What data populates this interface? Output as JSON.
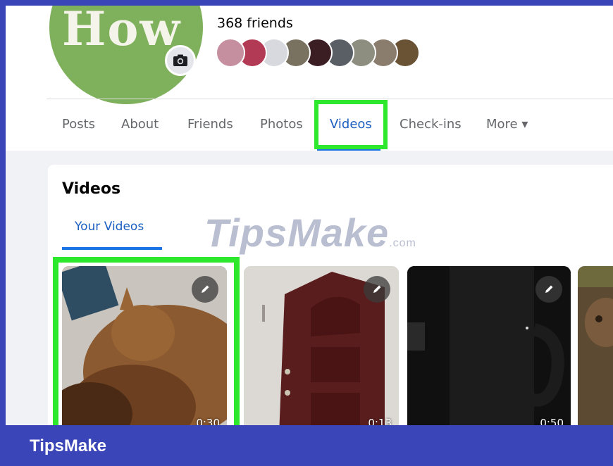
{
  "profile": {
    "avatar_text": "How",
    "friends_count": "368 friends",
    "friend_avatar_colors": [
      "#c58fa0",
      "#b33a55",
      "#d7d9de",
      "#7a7260",
      "#3b1d24",
      "#5a5f66",
      "#8d8e80",
      "#8a7d6e",
      "#6a5235"
    ]
  },
  "tabs": {
    "items": [
      {
        "label": "Posts"
      },
      {
        "label": "About"
      },
      {
        "label": "Friends"
      },
      {
        "label": "Photos"
      },
      {
        "label": "Videos"
      },
      {
        "label": "Check-ins"
      },
      {
        "label": "More ▾"
      }
    ],
    "active": "Videos"
  },
  "videos_section": {
    "title": "Videos",
    "subtab": "Your Videos",
    "items": [
      {
        "duration": "0:30",
        "icon": "pencil-icon"
      },
      {
        "duration": "0:13",
        "icon": "pencil-icon"
      },
      {
        "duration": "0:50",
        "icon": "pencil-icon"
      },
      {
        "duration": "",
        "icon": ""
      }
    ]
  },
  "watermark": {
    "text": "TipsMake",
    "suffix": ".com"
  },
  "footer": {
    "brand": "TipsMake"
  },
  "colors": {
    "highlight": "#2ee82e",
    "brand_bar": "#3a46b8",
    "active_tab": "#1b74e4",
    "avatar_bg": "#7fb05c"
  }
}
